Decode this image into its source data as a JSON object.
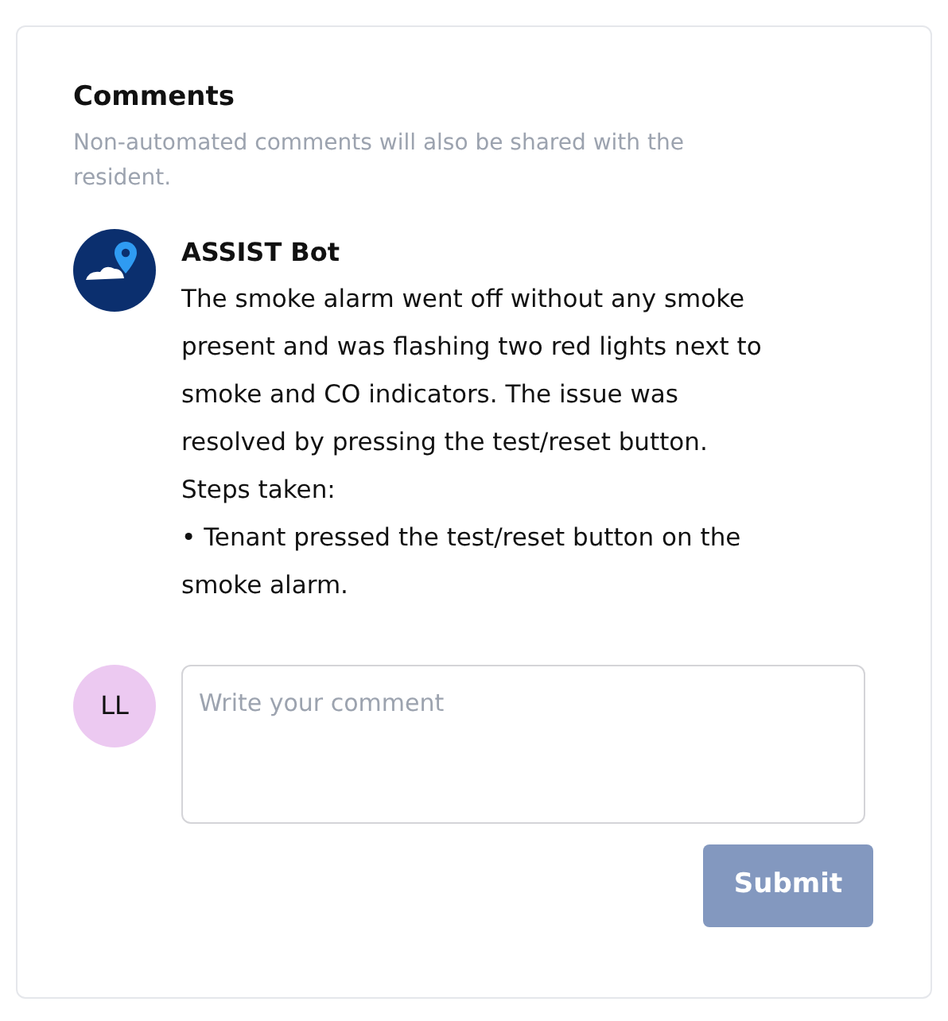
{
  "title": "Comments",
  "subtitle": "Non-automated comments will also be shared with the resident.",
  "comments": [
    {
      "author": "ASSIST Bot",
      "kind": "logo",
      "lines": [
        "The smoke alarm went off without any smoke",
        "present and was flashing two red lights next to",
        "smoke and CO indicators. The issue was",
        "resolved by pressing the test/reset button.",
        "Steps taken:",
        "• Tenant pressed the test/reset button on the",
        "smoke alarm."
      ]
    }
  ],
  "composer": {
    "initials": "LL",
    "placeholder": "Write your comment"
  },
  "submit": {
    "label": "Submit",
    "disabled": true
  }
}
